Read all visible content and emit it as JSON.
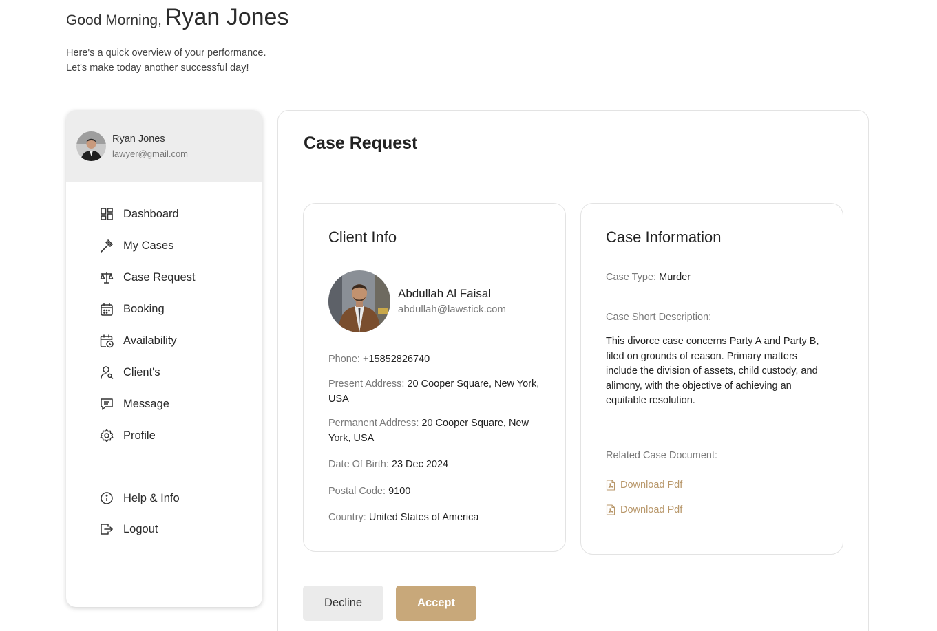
{
  "header": {
    "greeting_prefix": "Good Morning,",
    "user_name": "Ryan Jones",
    "subtitle_line1": "Here's a quick overview of your performance.",
    "subtitle_line2": "Let's make today another successful day!"
  },
  "sidebar": {
    "profile": {
      "name": "Ryan Jones",
      "email": "lawyer@gmail.com"
    },
    "items": [
      {
        "label": "Dashboard",
        "icon": "dashboard-icon"
      },
      {
        "label": "My Cases",
        "icon": "gavel-icon"
      },
      {
        "label": "Case Request",
        "icon": "scale-icon"
      },
      {
        "label": "Booking",
        "icon": "calendar-icon"
      },
      {
        "label": "Availability",
        "icon": "calendar-clock-icon"
      },
      {
        "label": "Client's",
        "icon": "user-search-icon"
      },
      {
        "label": "Message",
        "icon": "message-icon"
      },
      {
        "label": "Profile",
        "icon": "gear-icon"
      }
    ],
    "bottom_items": [
      {
        "label": "Help & Info",
        "icon": "info-icon"
      },
      {
        "label": "Logout",
        "icon": "logout-icon"
      }
    ]
  },
  "main": {
    "title": "Case Request",
    "client_info": {
      "title": "Client Info",
      "name": "Abdullah Al Faisal",
      "email": "abdullah@lawstick.com",
      "phone_label": "Phone:",
      "phone": "+15852826740",
      "present_label": "Present Address:",
      "present": "20 Cooper Square, New York, USA",
      "permanent_label": "Permanent Address:",
      "permanent": "20 Cooper Square, New York, USA",
      "dob_label": "Date Of Birth:",
      "dob": "23 Dec 2024",
      "postal_label": "Postal Code:",
      "postal": "9100",
      "country_label": "Country:",
      "country": "United States of America"
    },
    "case_info": {
      "title": "Case Information",
      "type_label": "Case Type:",
      "type": "Murder",
      "desc_label": "Case Short Description:",
      "description": "This divorce case concerns Party A and Party B, filed on grounds of reason. Primary matters include the division of assets, child custody, and alimony, with the objective of achieving an equitable resolution.",
      "doc_label": "Related Case Document:",
      "downloads": [
        "Download Pdf",
        "Download Pdf"
      ]
    },
    "actions": {
      "decline": "Decline",
      "accept": "Accept"
    }
  },
  "colors": {
    "accent": "#c8a87a",
    "link": "#b8976a",
    "muted": "#7a7a7a",
    "sidebar_header": "#ededed"
  }
}
